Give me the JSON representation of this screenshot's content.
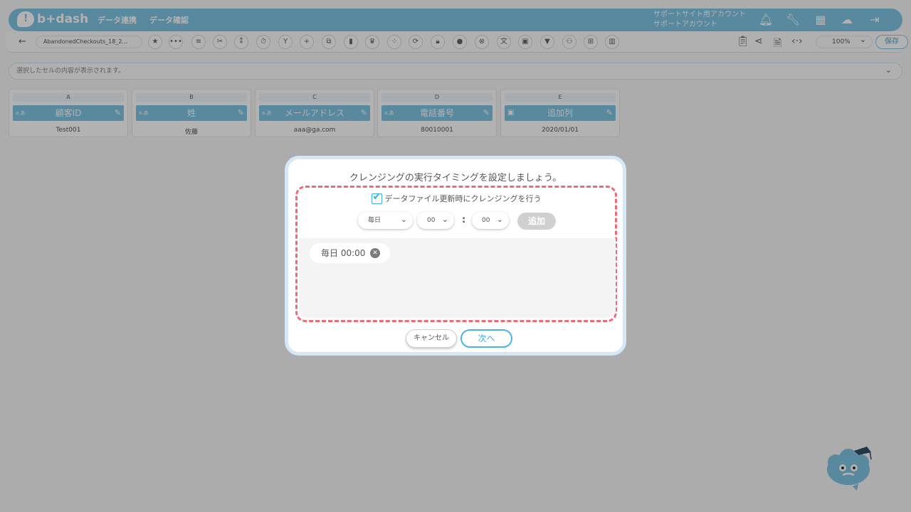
{
  "header": {
    "logo_text": "b+dash",
    "nav_items": [
      "データ連携",
      "データ確認"
    ],
    "account_line1": "サポートサイト用アカウント",
    "account_line2": "サポートアカウント"
  },
  "toolbar": {
    "filename": "AbandonedCheckouts_18_2...",
    "zoom": "100%",
    "save_label": "保存"
  },
  "cell_display": {
    "placeholder": "選択したセルの内容が表示されます。"
  },
  "columns": [
    {
      "letter": "A",
      "name": "顧客ID",
      "type_icon": "text-type-icon",
      "value": "Test001"
    },
    {
      "letter": "B",
      "name": "姓",
      "type_icon": "text-type-icon",
      "value": "佐藤"
    },
    {
      "letter": "C",
      "name": "メールアドレス",
      "type_icon": "text-type-icon",
      "value": "aaa@ga.com"
    },
    {
      "letter": "D",
      "name": "電話番号",
      "type_icon": "text-type-icon",
      "value": "80010001"
    },
    {
      "letter": "E",
      "name": "追加列",
      "type_icon": "calendar-icon",
      "value": "2020/01/01"
    }
  ],
  "modal": {
    "title": "クレンジングの実行タイミングを設定しましょう。",
    "checkbox_label": "データファイル更新時にクレンジングを行う",
    "checkbox_checked": true,
    "frequency_select": "毎日",
    "hour_select": "00",
    "minute_select": "00",
    "colon": ":",
    "add_label": "追加",
    "schedules": [
      {
        "label": "毎日 00:00"
      }
    ],
    "cancel_label": "キャンセル",
    "next_label": "次へ"
  },
  "colors": {
    "brand": "#7fc4e3",
    "accent": "#3faee0",
    "highlight_dash": "#ed6b77"
  }
}
